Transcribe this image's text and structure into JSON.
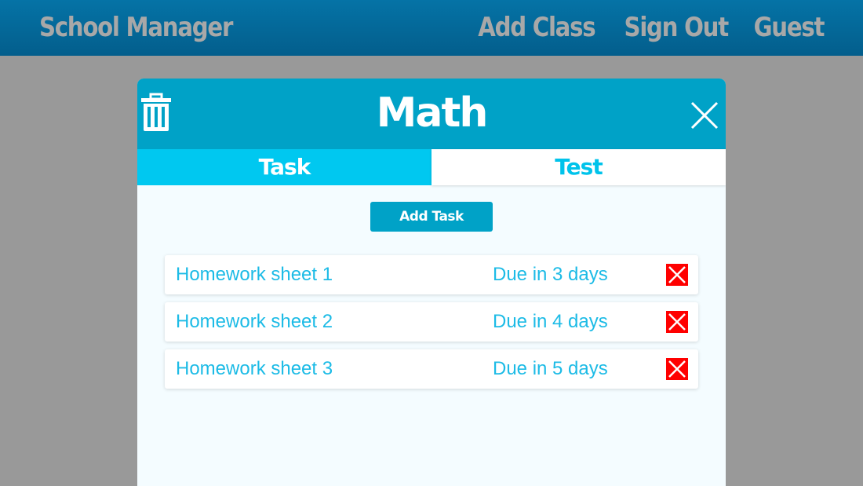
{
  "header": {
    "brand": "School Manager",
    "nav": [
      "Add Class",
      "Sign Out",
      "Guest"
    ],
    "background": "#035e8c"
  },
  "modal": {
    "title": "Math",
    "tabs": [
      {
        "label": "Task",
        "active": true
      },
      {
        "label": "Test",
        "active": false
      }
    ],
    "add_button": "Add Task",
    "tasks": [
      {
        "name": "Homework sheet 1",
        "due": "Due in 3 days"
      },
      {
        "name": "Homework sheet 2",
        "due": "Due in 4 days"
      },
      {
        "name": "Homework sheet 3",
        "due": "Due in 5 days"
      }
    ],
    "icons": {
      "delete_class": "trash-icon",
      "close": "close-icon",
      "delete_task": "red-x-icon"
    },
    "colors": {
      "header": "#00a2c7",
      "active_tab": "#00c8f0",
      "text": "#1cbbe6",
      "delete": "#ff0000"
    }
  }
}
